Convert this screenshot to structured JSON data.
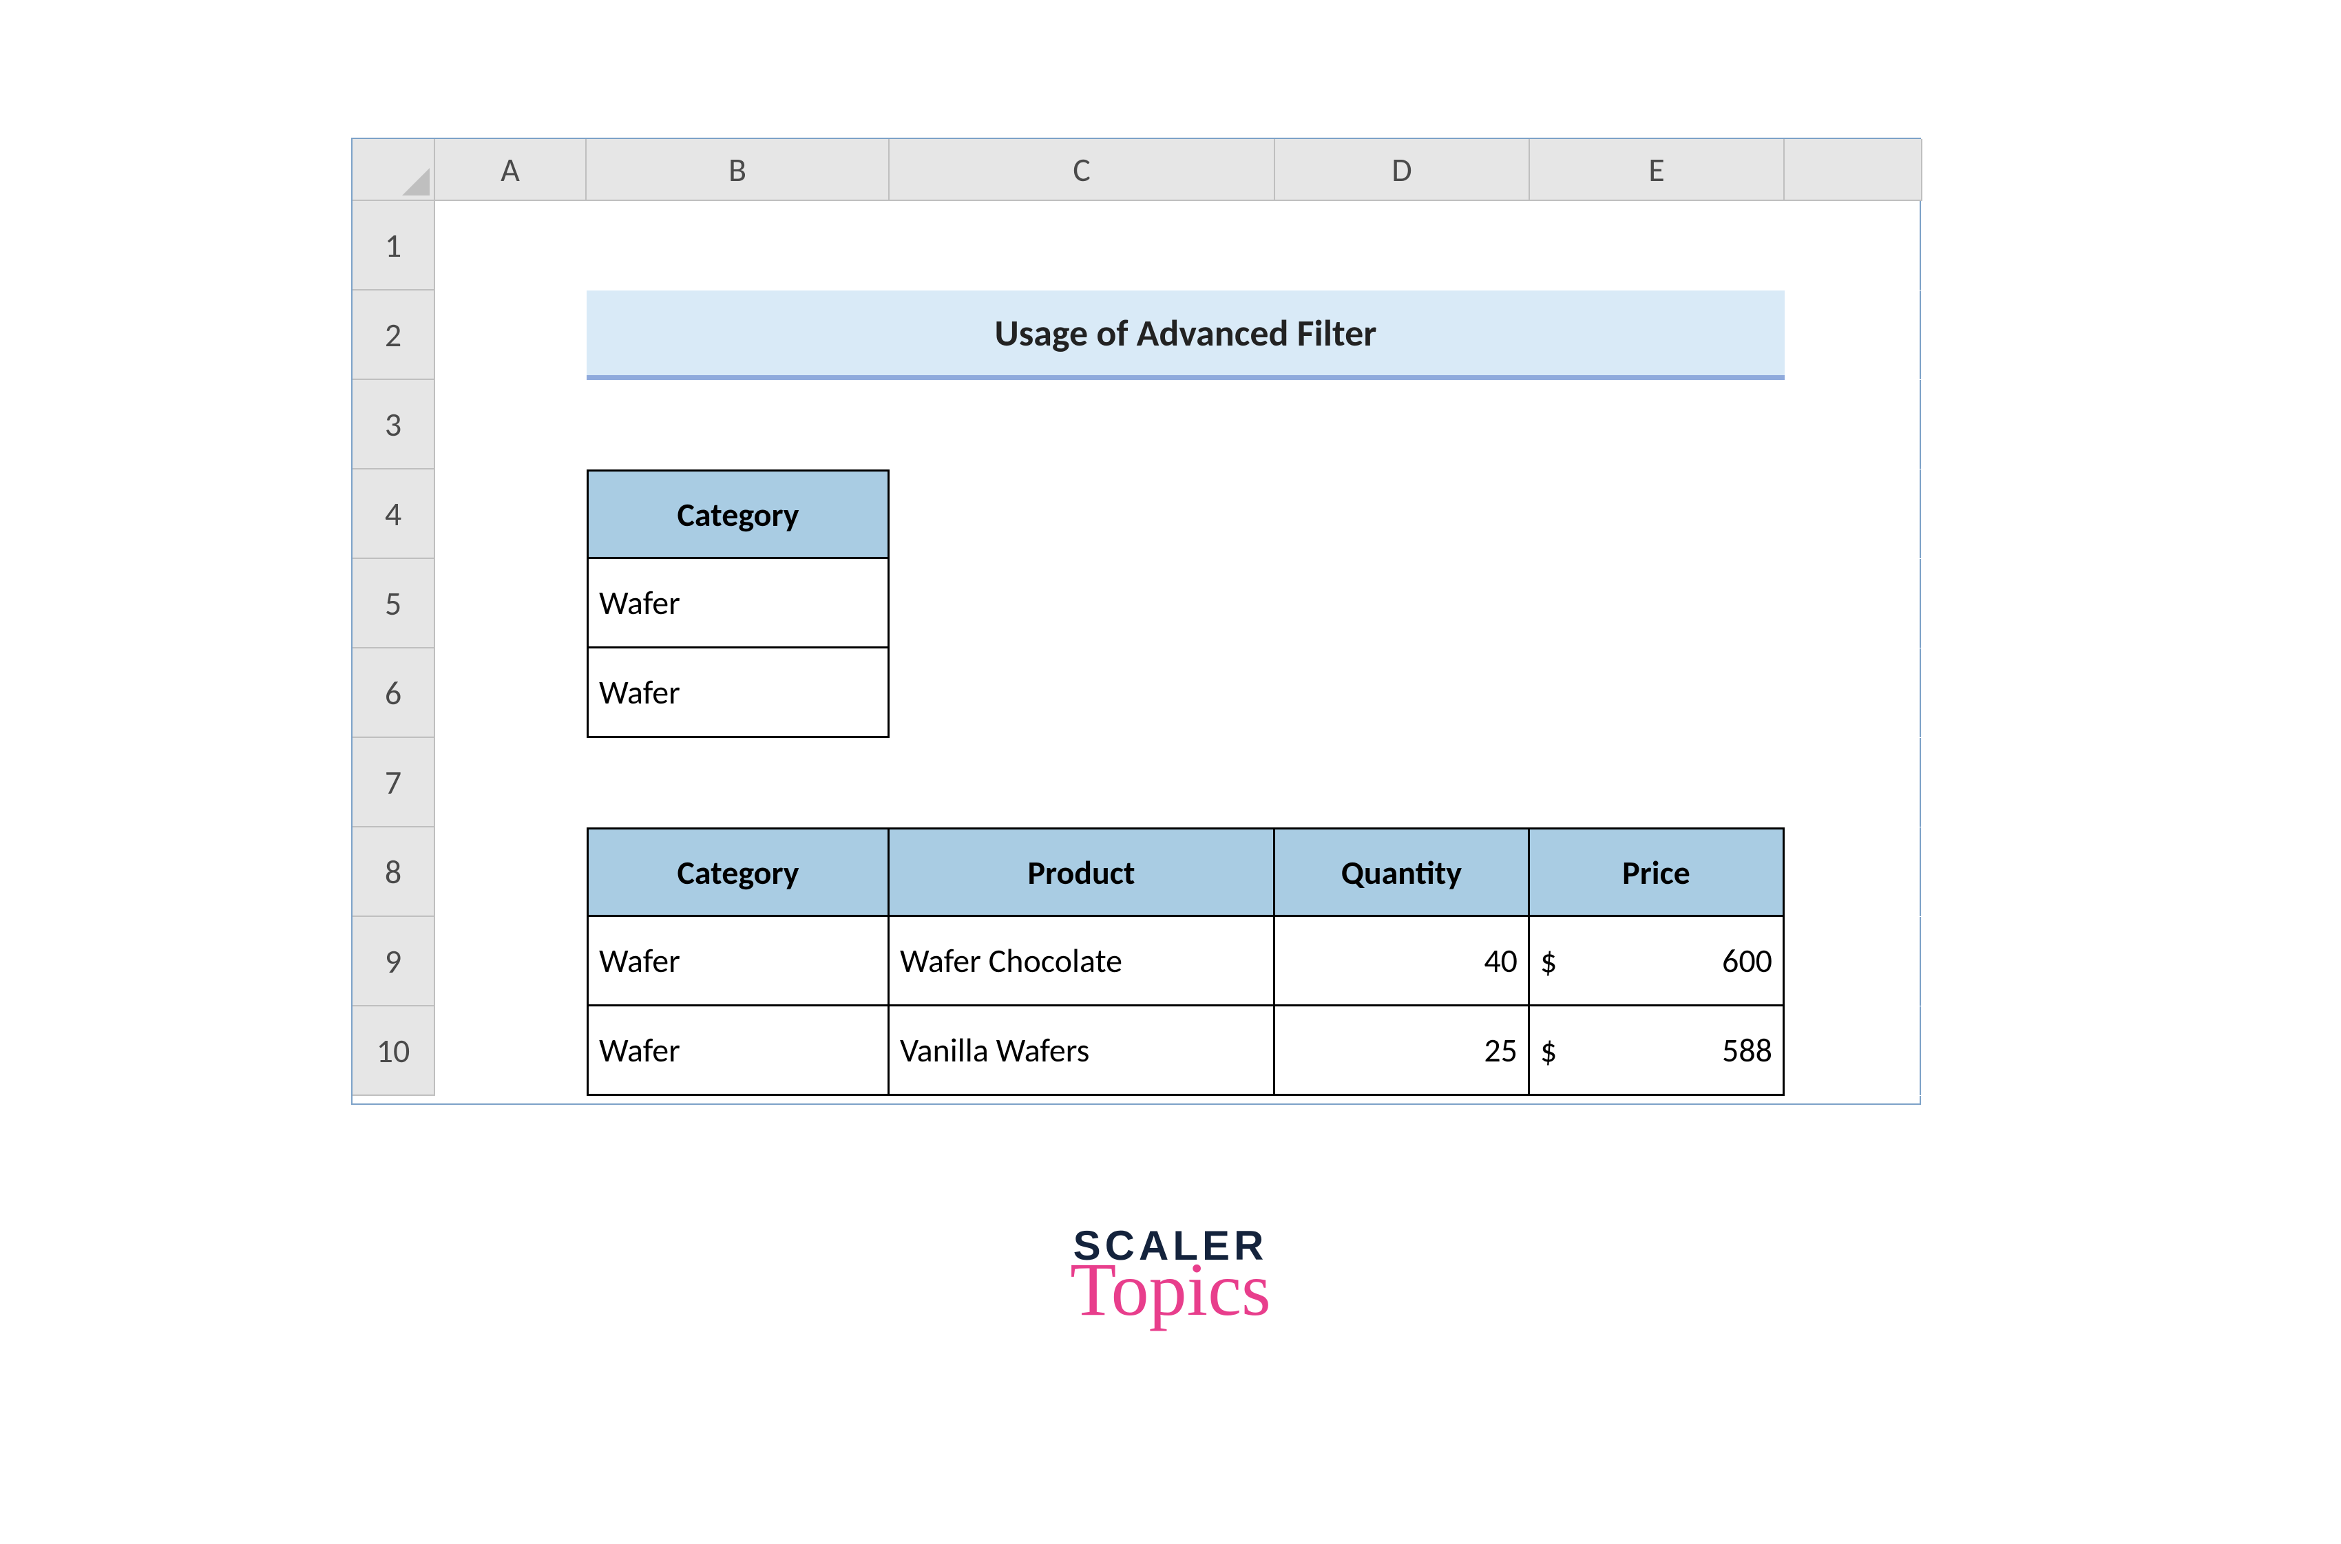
{
  "columns": [
    "A",
    "B",
    "C",
    "D",
    "E"
  ],
  "rows": [
    "1",
    "2",
    "3",
    "4",
    "5",
    "6",
    "7",
    "8",
    "9",
    "10"
  ],
  "title": "Usage of Advanced Filter",
  "criteria": {
    "header": "Category",
    "values": [
      "Wafer",
      "Wafer"
    ]
  },
  "results": {
    "headers": [
      "Category",
      "Product",
      "Quantity",
      "Price"
    ],
    "rows": [
      {
        "category": "Wafer",
        "product": "Wafer Chocolate",
        "quantity": "40",
        "currency": "$",
        "price": "600"
      },
      {
        "category": "Wafer",
        "product": "Vanilla Wafers",
        "quantity": "25",
        "currency": "$",
        "price": "588"
      }
    ]
  },
  "logo": {
    "line1": "SCALER",
    "line2": "Topics"
  }
}
